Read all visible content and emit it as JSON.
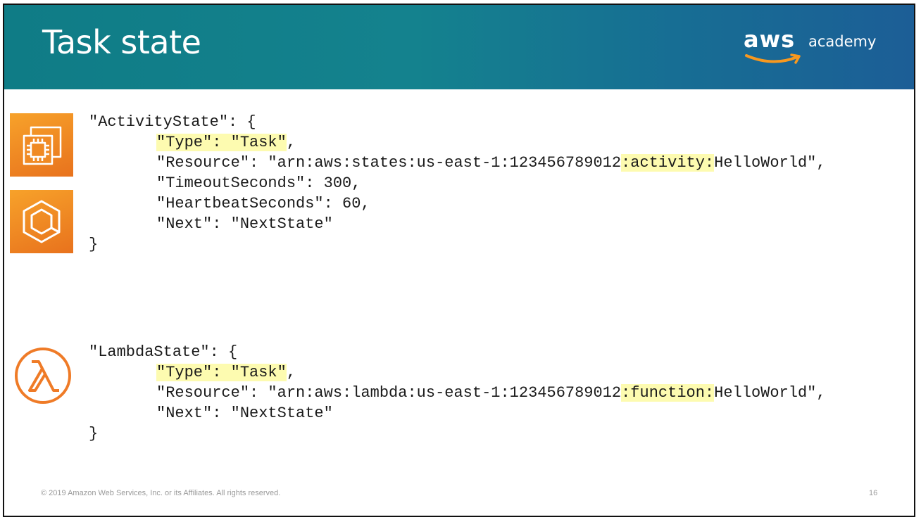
{
  "slide": {
    "title": "Task state",
    "logo": {
      "brand": "aws",
      "sub": "academy"
    },
    "footer": {
      "copyright": "© 2019 Amazon Web Services, Inc. or its Affiliates. All rights reserved.",
      "page_number": "16"
    }
  },
  "colors": {
    "header_start": "#0f7c86",
    "header_end": "#1c5e96",
    "icon_orange": "#f08a24",
    "highlight": "#fdfbb0",
    "smile": "#f7981f"
  },
  "icons": {
    "first": "ec2-compute-icon",
    "second": "ecs-container-icon",
    "third": "lambda-icon"
  },
  "activity_state": {
    "open": "\"ActivityState\": {",
    "type_key_value": "\"Type\": \"Task\"",
    "type_comma": ",",
    "resource_prefix": "\"Resource\": \"arn:aws:states:us-east-1:123456789012",
    "resource_highlight": ":activity:",
    "resource_suffix": "HelloWorld\",",
    "timeout": "\"TimeoutSeconds\": 300,",
    "heartbeat": "\"HeartbeatSeconds\": 60,",
    "next": "\"Next\": \"NextState\"",
    "close": "}"
  },
  "lambda_state": {
    "open": "\"LambdaState\": {",
    "type_key_value": "\"Type\": \"Task\"",
    "type_comma": ",",
    "resource_prefix": "\"Resource\": \"arn:aws:lambda:us-east-1:123456789012",
    "resource_highlight": ":function:",
    "resource_suffix": "HelloWorld\",",
    "next": "\"Next\": \"NextState\"",
    "close": "}"
  }
}
